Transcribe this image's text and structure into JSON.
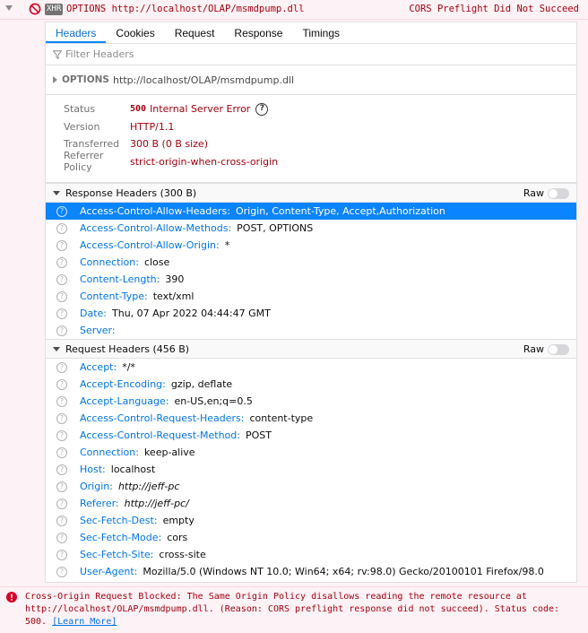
{
  "top": {
    "badge": "XHR",
    "method_url": "OPTIONS http://localhost/OLAP/msmdpump.dll",
    "status": "CORS Preflight Did Not Succeed"
  },
  "tabs": [
    "Headers",
    "Cookies",
    "Request",
    "Response",
    "Timings"
  ],
  "filter": {
    "placeholder": "Filter Headers"
  },
  "request_line": {
    "method": "OPTIONS",
    "url": "http://localhost/OLAP/msmdpump.dll"
  },
  "summary": {
    "status_label": "Status",
    "status_code": "500",
    "status_text": "Internal Server Error",
    "version_label": "Version",
    "version": "HTTP/1.1",
    "transferred_label": "Transferred",
    "transferred": "300 B (0 B size)",
    "referrer_label": "Referrer Policy",
    "referrer": "strict-origin-when-cross-origin"
  },
  "response_headers": {
    "title": "Response Headers (300 B)",
    "raw": "Raw",
    "rows": [
      {
        "name": "Access-Control-Allow-Headers:",
        "value": "Origin, Content-Type, Accept,Authorization"
      },
      {
        "name": "Access-Control-Allow-Methods:",
        "value": "POST, OPTIONS"
      },
      {
        "name": "Access-Control-Allow-Origin:",
        "value": "*"
      },
      {
        "name": "Connection:",
        "value": "close"
      },
      {
        "name": "Content-Length:",
        "value": "390"
      },
      {
        "name": "Content-Type:",
        "value": "text/xml"
      },
      {
        "name": "Date:",
        "value": "Thu, 07 Apr 2022 04:44:47 GMT"
      },
      {
        "name": "Server:",
        "value": ""
      }
    ]
  },
  "request_headers": {
    "title": "Request Headers (456 B)",
    "raw": "Raw",
    "rows": [
      {
        "name": "Accept:",
        "value": "*/*"
      },
      {
        "name": "Accept-Encoding:",
        "value": "gzip, deflate"
      },
      {
        "name": "Accept-Language:",
        "value": "en-US,en;q=0.5"
      },
      {
        "name": "Access-Control-Request-Headers:",
        "value": "content-type"
      },
      {
        "name": "Access-Control-Request-Method:",
        "value": "POST"
      },
      {
        "name": "Connection:",
        "value": "keep-alive"
      },
      {
        "name": "Host:",
        "value": "localhost"
      },
      {
        "name": "Origin:",
        "value": "http://jeff-pc"
      },
      {
        "name": "Referer:",
        "value": "http://jeff-pc/"
      },
      {
        "name": "Sec-Fetch-Dest:",
        "value": "empty"
      },
      {
        "name": "Sec-Fetch-Mode:",
        "value": "cors"
      },
      {
        "name": "Sec-Fetch-Site:",
        "value": "cross-site"
      },
      {
        "name": "User-Agent:",
        "value": "Mozilla/5.0 (Windows NT 10.0; Win64; x64; rv:98.0) Gecko/20100101 Firefox/98.0"
      }
    ]
  },
  "console": {
    "message": "Cross-Origin Request Blocked: The Same Origin Policy disallows reading the remote resource at http://localhost/OLAP/msmdpump.dll. (Reason: CORS preflight response did not succeed). Status code: 500.",
    "link": "[Learn More]"
  },
  "colors": {
    "error": "#a4000f",
    "link": "#0074e8",
    "selected": "#0a84ff"
  },
  "icons": [
    "error-icon",
    "filter-icon",
    "help-icon",
    "question-icon"
  ]
}
